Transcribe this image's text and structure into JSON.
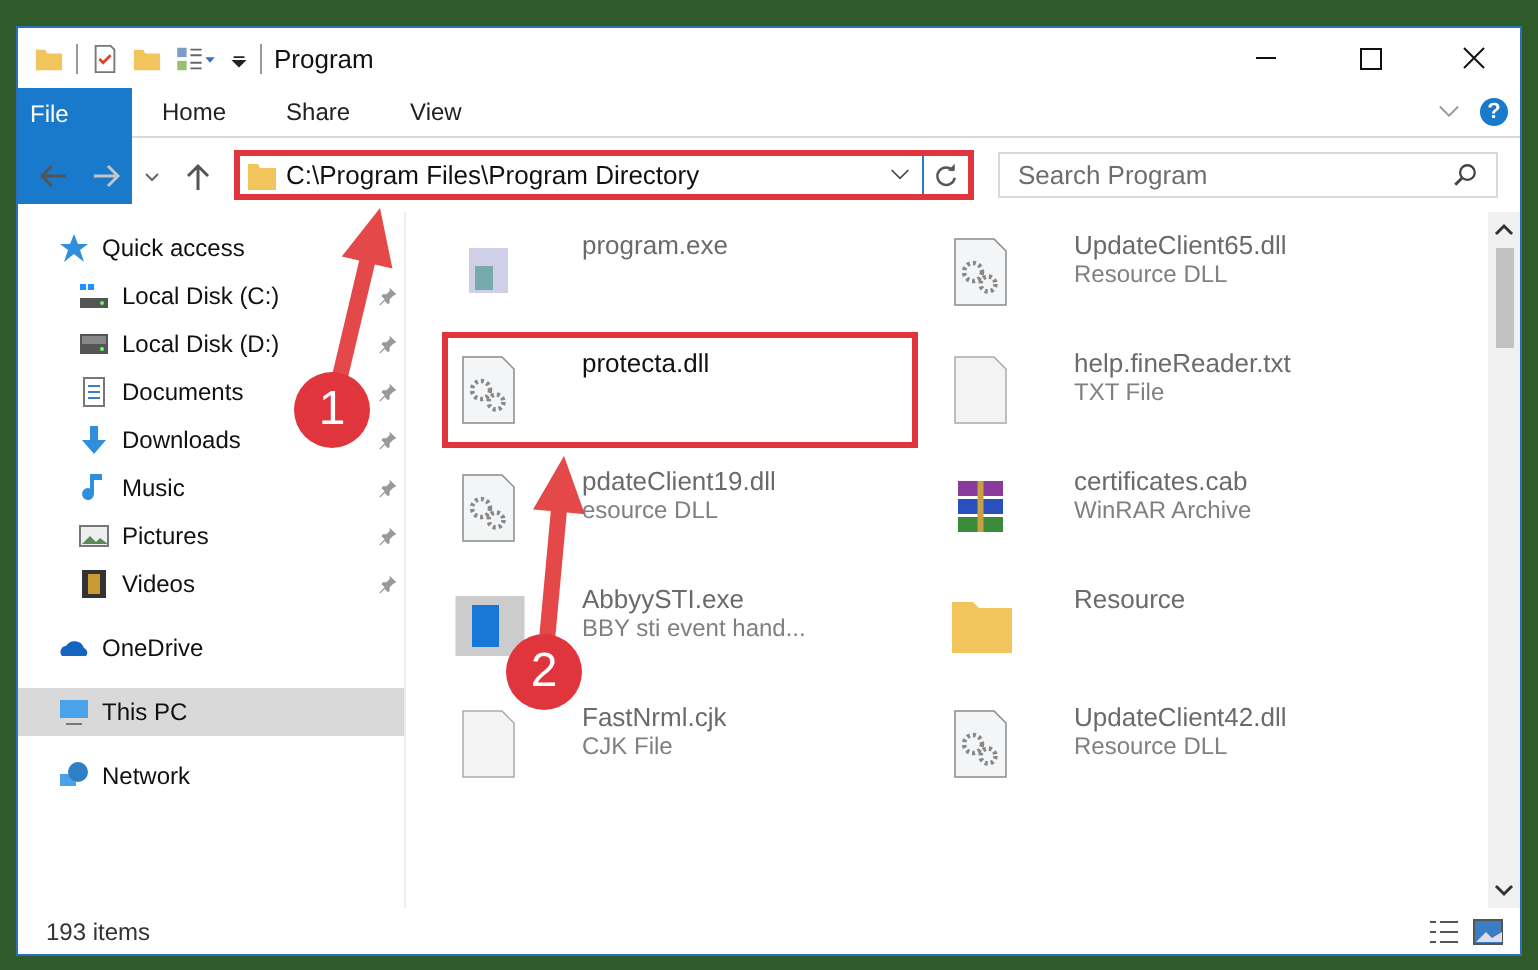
{
  "window": {
    "title": "Program"
  },
  "ribbon": {
    "tabs": [
      {
        "label": "File",
        "kind": "file"
      },
      {
        "label": "Home",
        "kind": "tab"
      },
      {
        "label": "Share",
        "kind": "tab"
      },
      {
        "label": "View",
        "kind": "tab"
      }
    ],
    "help": "?"
  },
  "address_bar": {
    "path": "C:\\Program Files\\Program Directory",
    "highlighted": true
  },
  "search": {
    "placeholder": "Search Program"
  },
  "sidebar": {
    "items": [
      {
        "label": "Quick access",
        "kind": "star",
        "selected": false,
        "children": [
          {
            "label": "Local Disk (C:)",
            "kind": "system-drive",
            "pinned": true
          },
          {
            "label": "Local Disk (D:)",
            "kind": "drive",
            "pinned": true
          },
          {
            "label": "Documents",
            "kind": "documents",
            "pinned": true
          },
          {
            "label": "Downloads",
            "kind": "downloads",
            "pinned": true
          },
          {
            "label": "Music",
            "kind": "music",
            "pinned": true
          },
          {
            "label": "Pictures",
            "kind": "pictures",
            "pinned": true
          },
          {
            "label": "Videos",
            "kind": "videos",
            "pinned": true
          }
        ]
      },
      {
        "label": "OneDrive",
        "kind": "cloud",
        "selected": false
      },
      {
        "label": "This PC",
        "kind": "pc",
        "selected": true
      },
      {
        "label": "Network",
        "kind": "network",
        "selected": false
      }
    ]
  },
  "files": [
    {
      "name": "program.exe",
      "kind": "installer",
      "blurred": true
    },
    {
      "name": "UpdateClient65.dll",
      "type": "Resource DLL",
      "kind": "dll",
      "blurred": true
    },
    {
      "name": "protecta.dll",
      "kind": "dll",
      "blurred": false,
      "highlighted": true
    },
    {
      "name": "help.fineReader.txt",
      "type": "TXT File",
      "kind": "file",
      "blurred": true
    },
    {
      "name": "pdateClient19.dll",
      "type": "esource DLL",
      "kind": "dll",
      "blurred": true
    },
    {
      "name": "certificates.cab",
      "type": "WinRAR Archive",
      "kind": "archive",
      "blurred": true
    },
    {
      "name": "AbbyySTI.exe",
      "type": "BBY sti event hand...",
      "kind": "app",
      "blurred": true
    },
    {
      "name": "Resource",
      "kind": "folder",
      "blurred": true
    },
    {
      "name": "FastNrml.cjk",
      "type": "CJK File",
      "kind": "file",
      "blurred": true
    },
    {
      "name": "UpdateClient42.dll",
      "type": "Resource DLL",
      "kind": "dll",
      "blurred": true
    }
  ],
  "annotations": [
    {
      "number": "1"
    },
    {
      "number": "2"
    }
  ],
  "status_bar": {
    "count": "193 items"
  }
}
